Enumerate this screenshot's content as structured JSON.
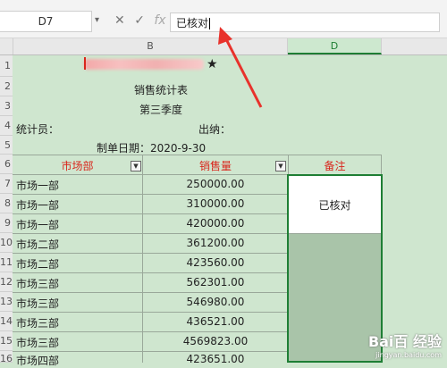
{
  "formula_bar": {
    "cell_ref": "D7",
    "icons": [
      "close-icon",
      "check-icon",
      "fx-icon"
    ],
    "fx_label": "fx",
    "content": "已核对"
  },
  "columns": [
    "B",
    "D"
  ],
  "rows": [
    "1",
    "2",
    "3",
    "4",
    "5",
    "6",
    "7",
    "8",
    "9",
    "10",
    "11",
    "12",
    "13",
    "14",
    "15",
    "16"
  ],
  "title_block": {
    "title": "销售统计表",
    "quarter": "第三季度",
    "stat_label": "统计员：",
    "cashier_label": "出纳：",
    "date_label": "制单日期：2020-9-30",
    "star": "★"
  },
  "table": {
    "headers": [
      "市场部",
      "销售量",
      "备注"
    ],
    "rows": [
      {
        "dept": "市场一部",
        "qty": "250000.00"
      },
      {
        "dept": "市场一部",
        "qty": "310000.00"
      },
      {
        "dept": "市场一部",
        "qty": "420000.00"
      },
      {
        "dept": "市场二部",
        "qty": "361200.00"
      },
      {
        "dept": "市场二部",
        "qty": "423560.00"
      },
      {
        "dept": "市场三部",
        "qty": "562301.00"
      },
      {
        "dept": "市场三部",
        "qty": "546980.00"
      },
      {
        "dept": "市场三部",
        "qty": "436521.00"
      },
      {
        "dept": "市场三部",
        "qty": "4569823.00"
      },
      {
        "dept": "市场四部",
        "qty": "423651.00"
      }
    ],
    "remark": "已核对"
  },
  "colors": {
    "header_red": "#d9261c",
    "sheet_green": "#cfe6cf",
    "selection_green": "#1e7e34",
    "arrow_red": "#e8322c"
  },
  "watermark": {
    "brand": "Bai百 经验",
    "url": "jingyan.baidu.com"
  }
}
